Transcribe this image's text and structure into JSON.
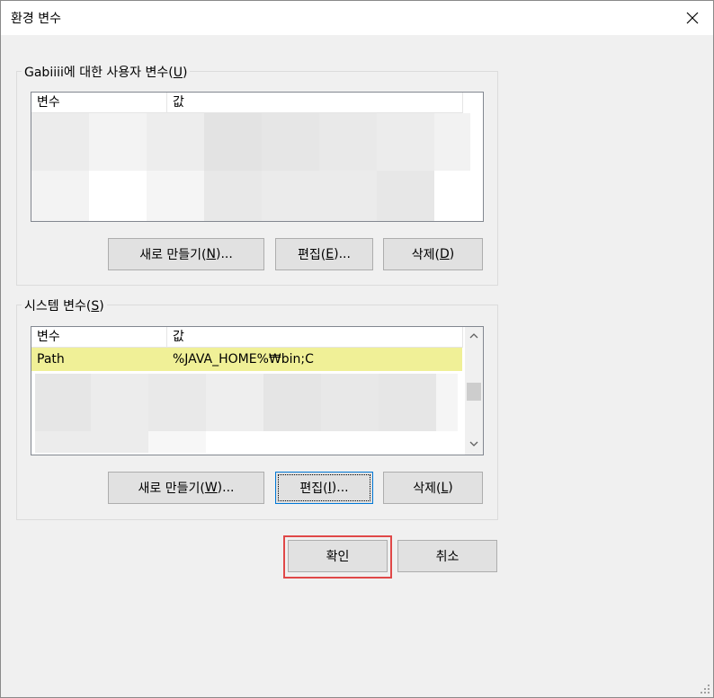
{
  "window": {
    "title": "환경 변수"
  },
  "user_vars": {
    "legend_prefix": "Gabiiii에 대한 사용자 변수(",
    "legend_key": "U",
    "legend_suffix": ")",
    "col_var": "변수",
    "col_val": "값",
    "buttons": {
      "new_prefix": "새로 만들기(",
      "new_key": "N",
      "new_suffix": ")...",
      "edit_prefix": "편집(",
      "edit_key": "E",
      "edit_suffix": ")...",
      "delete_prefix": "삭제(",
      "delete_key": "D",
      "delete_suffix": ")"
    }
  },
  "system_vars": {
    "legend_prefix": "시스템 변수(",
    "legend_key": "S",
    "legend_suffix": ")",
    "col_var": "변수",
    "col_val": "값",
    "rows": [
      {
        "name": "Path",
        "value": "%JAVA_HOME%₩bin;C"
      }
    ],
    "buttons": {
      "new_prefix": "새로 만들기(",
      "new_key": "W",
      "new_suffix": ")...",
      "edit_prefix": "편집(",
      "edit_key": "I",
      "edit_suffix": ")...",
      "delete_prefix": "삭제(",
      "delete_key": "L",
      "delete_suffix": ")"
    }
  },
  "dialog_buttons": {
    "ok": "확인",
    "cancel": "취소"
  },
  "colors": {
    "selected_row": "#f0f097",
    "highlight_border": "#e04848",
    "focus_border": "#0078d7"
  }
}
